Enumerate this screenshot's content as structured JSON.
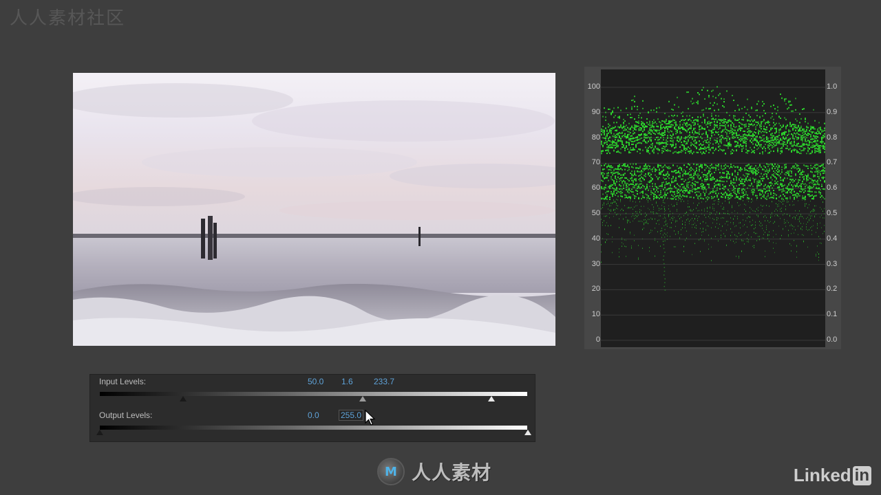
{
  "watermark": {
    "top_left": "人人素材社区",
    "center_text": "人人素材"
  },
  "brand": {
    "linkedin_text": "Linked",
    "linkedin_badge": "in"
  },
  "waveform": {
    "left_scale": [
      "100",
      "90",
      "80",
      "70",
      "60",
      "50",
      "40",
      "30",
      "20",
      "10",
      "0"
    ],
    "right_scale": [
      "1.0",
      "0.9",
      "0.8",
      "0.7",
      "0.6",
      "0.5",
      "0.4",
      "0.3",
      "0.2",
      "0.1",
      "0.0"
    ],
    "trace_color": "#2ee02e",
    "background_color": "#1f1f1f"
  },
  "levels": {
    "input_label": "Input Levels:",
    "input_black": "50.0",
    "input_gamma": "1.6",
    "input_white": "233.7",
    "output_label": "Output Levels:",
    "output_black": "0.0",
    "output_white": "255.0"
  },
  "colors": {
    "accent_value": "#5fa3d9",
    "background": "#3e3e3e",
    "panel": "#2c2c2c"
  },
  "icons": {
    "cursor": "pointer-cursor-icon",
    "logo": "rr-logo-icon"
  }
}
